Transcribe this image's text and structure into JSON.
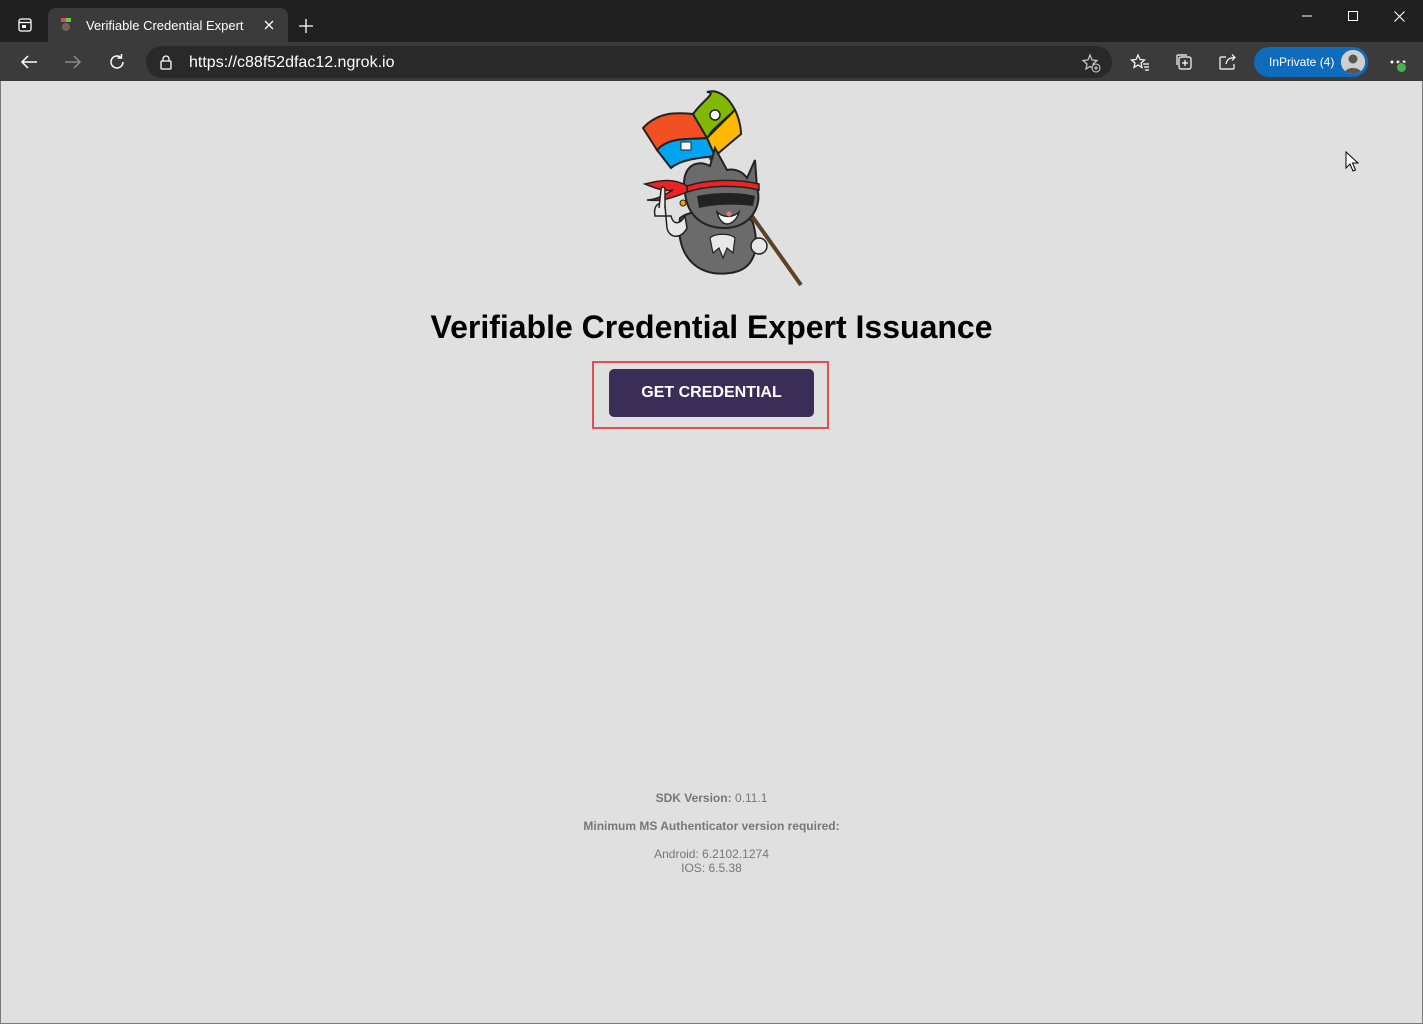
{
  "browser": {
    "tab": {
      "title": "Verifiable Credential Expert"
    },
    "address_bar": {
      "scheme": "https://",
      "host": "c88f52dfac12.ngrok.io"
    },
    "profile": {
      "label": "InPrivate (4)"
    },
    "colors": {
      "inprivate_badge": "#0f6cbd",
      "update_dot": "#4caf50"
    }
  },
  "page": {
    "heading": "Verifiable Credential Expert Issuance",
    "primary_button": {
      "label": "GET CREDENTIAL",
      "color": "#3a2e58",
      "highlight_color": "#e05050"
    },
    "footer": {
      "sdk_label": "SDK Version:",
      "sdk_value": "0.11.1",
      "min_version_label": "Minimum MS Authenticator version required:",
      "android": "Android: 6.2102.1274",
      "ios": "IOS: 6.5.38"
    }
  }
}
